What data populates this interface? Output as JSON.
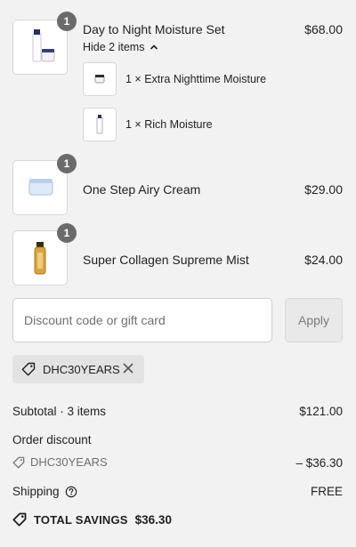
{
  "items": [
    {
      "quantity_badge": "1",
      "name": "Day to Night Moisture Set",
      "price": "$68.00",
      "toggle_label": "Hide 2 items",
      "subitems": [
        {
          "label": "1 × Extra Nighttime Moisture"
        },
        {
          "label": "1 × Rich Moisture"
        }
      ]
    },
    {
      "quantity_badge": "1",
      "name": "One Step Airy Cream",
      "price": "$29.00"
    },
    {
      "quantity_badge": "1",
      "name": "Super Collagen Supreme Mist",
      "price": "$24.00"
    }
  ],
  "discount": {
    "placeholder": "Discount code or gift card",
    "apply_label": "Apply",
    "applied_code": "DHC30YEARS"
  },
  "summary": {
    "subtotal_label": "Subtotal · 3 items",
    "subtotal_value": "$121.00",
    "order_discount_label": "Order discount",
    "order_discount_code": "DHC30YEARS",
    "order_discount_value": "– $36.30",
    "shipping_label": "Shipping",
    "shipping_value": "FREE",
    "total_savings_label": "TOTAL SAVINGS",
    "total_savings_value": "$36.30"
  },
  "icons": {
    "badge": "quantity-badge",
    "toggle": "chevron-up-icon",
    "tag": "tag-icon",
    "remove": "close-icon",
    "help": "help-circle-icon"
  },
  "colors": {
    "background": "#f2f2f2",
    "badge": "#6b6b6b",
    "chip": "#e3e3e3",
    "apply_disabled": "#e9e9e9"
  }
}
